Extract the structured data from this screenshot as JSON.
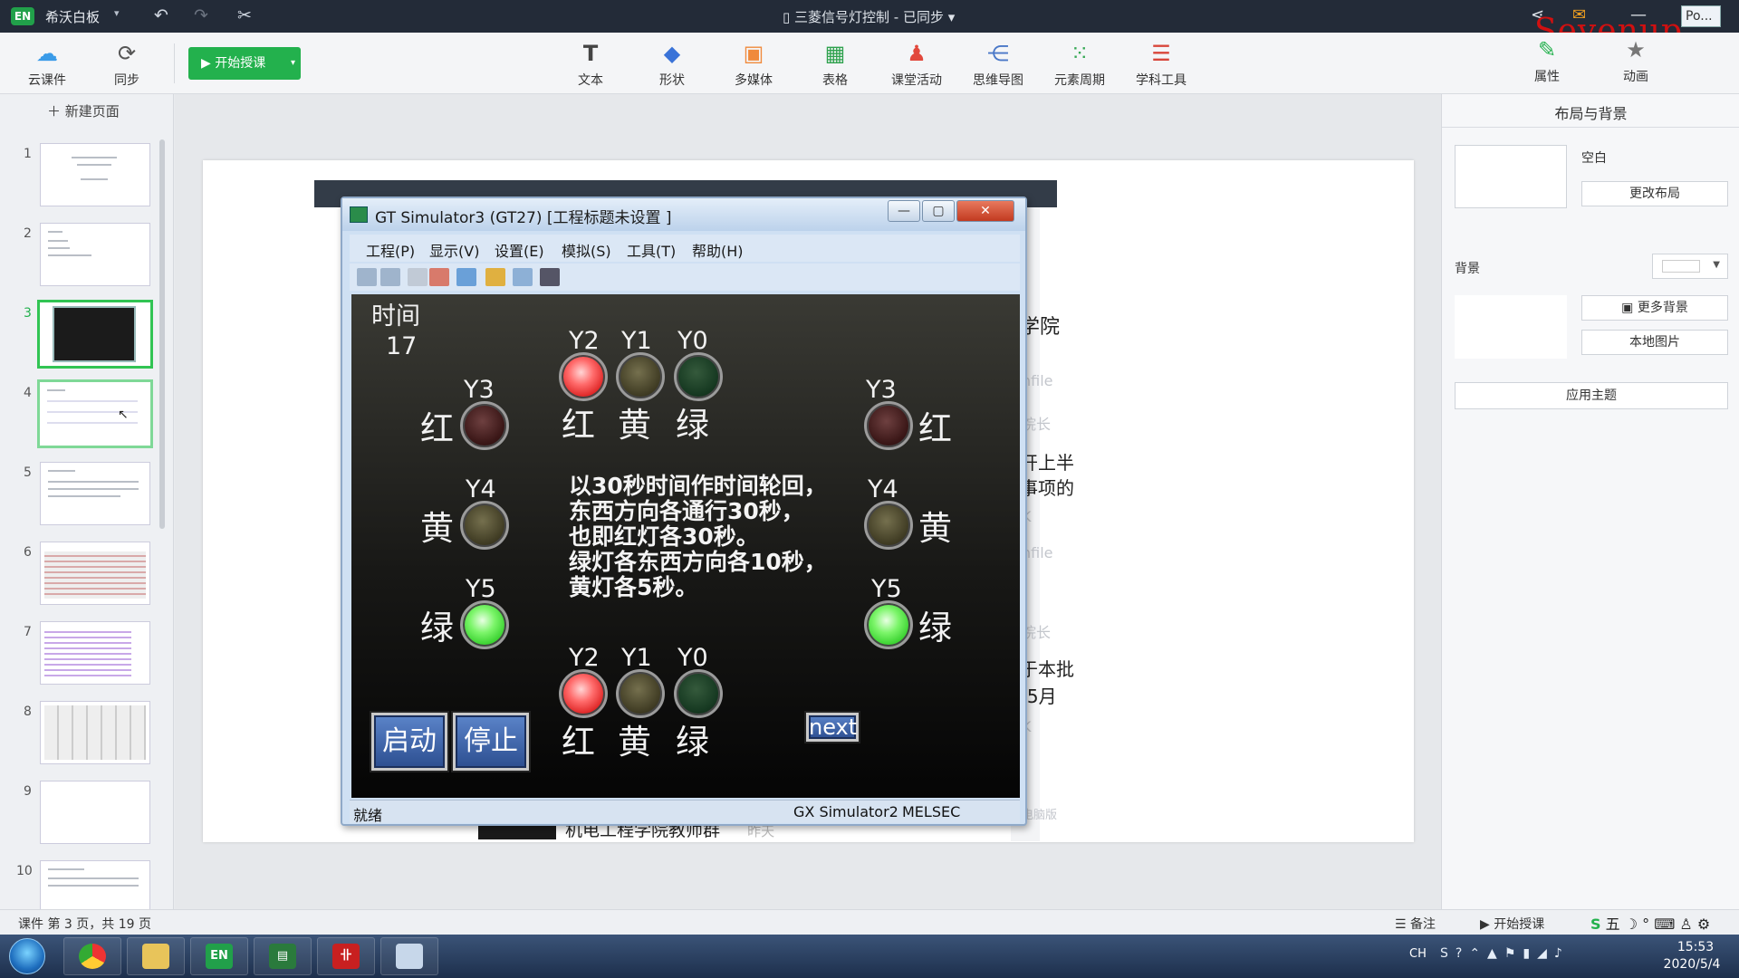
{
  "app": {
    "logo": "EN",
    "name": "希沃白板",
    "document_title": "三菱信号灯控制 - 已同步",
    "po_button": "Po...",
    "watermark": "Sevenup"
  },
  "ribbon": {
    "cloud": "云课件",
    "sync": "同步",
    "start_class": "开始授课",
    "tools": [
      "文本",
      "形状",
      "多媒体",
      "表格",
      "课堂活动",
      "思维导图",
      "元素周期",
      "学科工具"
    ],
    "properties": "属性",
    "animation": "动画"
  },
  "left_panel": {
    "new_page": "新建页面",
    "slides": [
      "1",
      "2",
      "3",
      "4",
      "5",
      "6",
      "7",
      "8",
      "9",
      "10"
    ],
    "active_index": 3
  },
  "slide_background": {
    "fragments": [
      "学院",
      "nfile",
      "院长",
      "开上半",
      "事项的",
      "K",
      "nfile",
      "院长",
      "于本批",
      "t5月",
      "K",
      "电脑版"
    ],
    "footer_text": "机电工程学院教师群",
    "footer_time": "昨天"
  },
  "simulator": {
    "title": "GT Simulator3 (GT27)  [工程标题未设置 ]",
    "menu": [
      "工程(P)",
      "显示(V)",
      "设置(E)",
      "模拟(S)",
      "工具(T)",
      "帮助(H)"
    ],
    "time_label": "时间",
    "time_value": "17",
    "labels": {
      "y0": "Y0",
      "y1": "Y1",
      "y2": "Y2",
      "y3": "Y3",
      "y4": "Y4",
      "y5": "Y5",
      "red": "红",
      "yellow": "黄",
      "green": "绿"
    },
    "description": "以30秒时间作时间轮回，\n东西方向各通行30秒，\n也即红灯各30秒。\n绿灯各东西方向各10秒，\n黄灯各5秒。",
    "btn_start": "启动",
    "btn_stop": "停止",
    "btn_next": "next",
    "status_ready": "就绪",
    "status_gx": "GX Simulator2",
    "status_melsec": "MELSEC",
    "lamp_colors": {
      "red_on": "#ff4d4d",
      "green_on": "#6cf25a"
    }
  },
  "right_panel": {
    "title": "布局与背景",
    "layout_name": "空白",
    "change_layout": "更改布局",
    "background_label": "背景",
    "more_backgrounds": "更多背景",
    "local_image": "本地图片",
    "apply_theme": "应用主题"
  },
  "status_bar": {
    "page_info": "课件 第 3 页，共 19 页",
    "notes": "备注",
    "start_class": "开始授课"
  },
  "taskbar": {
    "input_lang": "CH",
    "time": "15:53",
    "date": "2020/5/4"
  }
}
